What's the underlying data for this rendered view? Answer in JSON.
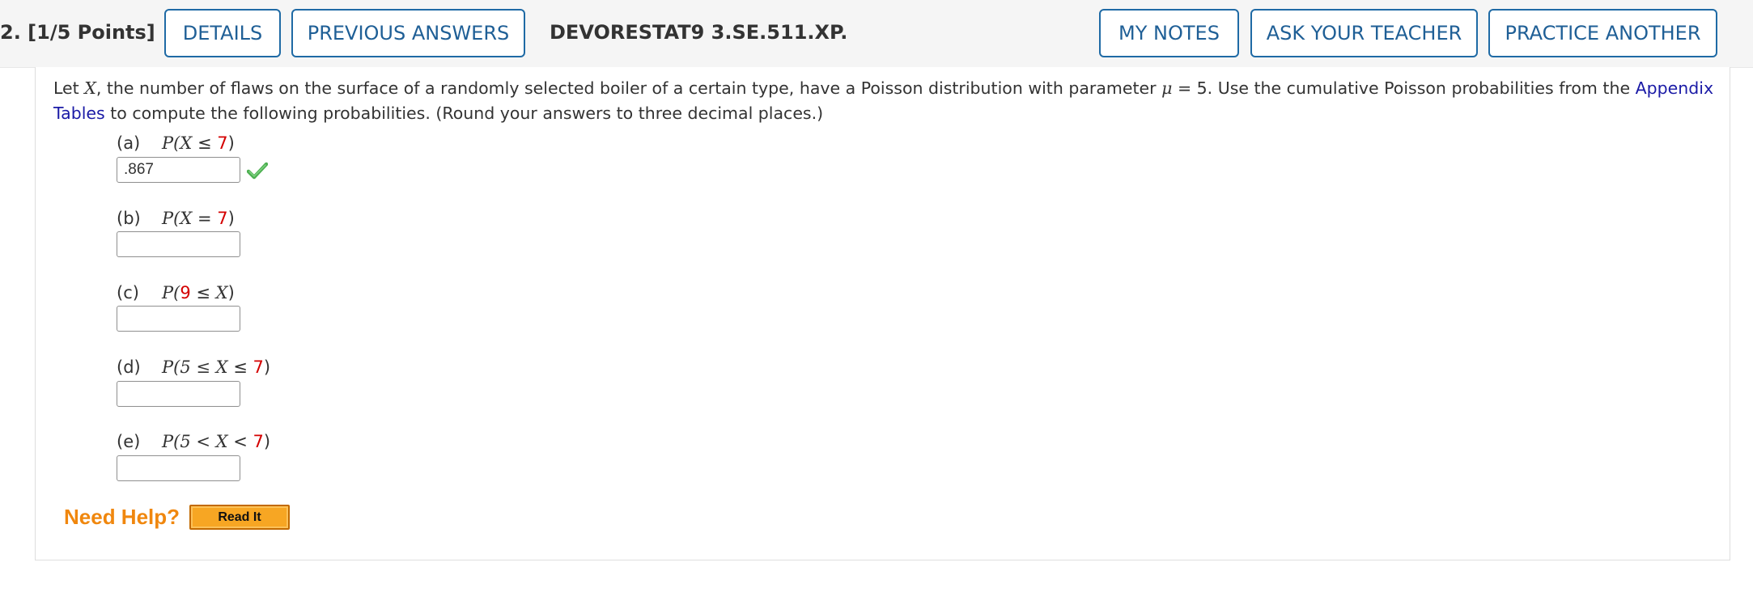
{
  "question": {
    "title": "2.  [1/5 Points]",
    "code": "DEVORESTAT9 3.SE.511.XP."
  },
  "header_buttons": {
    "details": "DETAILS",
    "previous_answers": "PREVIOUS ANSWERS",
    "my_notes": "MY NOTES",
    "ask_teacher": "ASK YOUR TEACHER",
    "practice_another": "PRACTICE ANOTHER"
  },
  "problem": {
    "intro": "Let ",
    "var_x": "X",
    "text1": ", the number of flaws on the surface of a randomly selected boiler of a certain type, have a Poisson distribution with parameter ",
    "mu": "μ",
    "text2": " = 5. Use the cumulative Poisson probabilities from the ",
    "link": "Appendix Tables",
    "text3": " to compute the following probabilities. (Round your answers to three decimal places.)"
  },
  "parts": [
    {
      "letter": "(a)",
      "pre": "P(",
      "var1": "X",
      "op": " ≤ ",
      "red": "7",
      "post": ")",
      "answer": ".867",
      "correct": true
    },
    {
      "letter": "(b)",
      "pre": "P(",
      "var1": "X",
      "op": " = ",
      "red": "7",
      "post": ")",
      "answer": ""
    },
    {
      "letter": "(c)",
      "pre": "P(",
      "red": "9",
      "op": " ≤ ",
      "var1": "X",
      "post": ")",
      "answer": ""
    },
    {
      "letter": "(d)",
      "pre": "P(5 ≤ ",
      "var1": "X",
      "op": " ≤ ",
      "red": "7",
      "post": ")",
      "answer": ""
    },
    {
      "letter": "(e)",
      "pre": "P(5 < ",
      "var1": "X",
      "op": " < ",
      "red": "7",
      "post": ")",
      "answer": ""
    }
  ],
  "help": {
    "label": "Need Help?",
    "read_it": "Read It"
  },
  "icons": {
    "check": "check-mark-icon"
  },
  "colors": {
    "button_border": "#1f6aa5",
    "link": "#1a1aa6",
    "red_value": "#d40000",
    "need_help": "#f0870e",
    "read_it_bg": "#f7a623",
    "check": "#4caf50"
  }
}
